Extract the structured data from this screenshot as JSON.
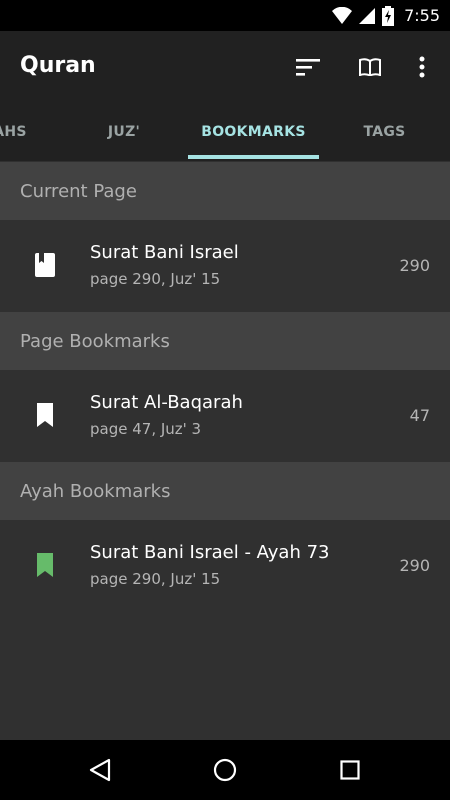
{
  "status_bar": {
    "time": "7:55",
    "icons": [
      "wifi-icon",
      "signal-icon",
      "battery-charging-icon"
    ]
  },
  "toolbar": {
    "title": "Quran",
    "actions": [
      "sort-icon",
      "open-book-icon",
      "more-vert-icon"
    ]
  },
  "tabs": [
    {
      "label": "AHS",
      "active": false
    },
    {
      "label": "JUZ'",
      "active": false
    },
    {
      "label": "BOOKMARKS",
      "active": true
    },
    {
      "label": "TAGS",
      "active": false
    }
  ],
  "sections": {
    "current_page": {
      "header": "Current Page",
      "items": [
        {
          "title": "Surat Bani Israel",
          "subtitle": "page 290, Juz' 15",
          "count": "290",
          "icon": "book-page-icon"
        }
      ]
    },
    "page_bookmarks": {
      "header": "Page Bookmarks",
      "items": [
        {
          "title": "Surat Al-Baqarah",
          "subtitle": "page 47, Juz' 3",
          "count": "47",
          "icon": "bookmark-icon"
        }
      ]
    },
    "ayah_bookmarks": {
      "header": "Ayah Bookmarks",
      "items": [
        {
          "title": "Surat Bani Israel - Ayah 73",
          "subtitle": "page 290, Juz' 15",
          "count": "290",
          "icon": "bookmark-green-icon"
        }
      ]
    }
  },
  "colors": {
    "toolbar_bg": "#212121",
    "content_bg": "#303030",
    "section_bg": "#424242",
    "tab_accent": "#a6e3e3",
    "ayah_bookmark": "#66bb6a"
  },
  "nav_bar": {
    "buttons": [
      "back-icon",
      "home-icon",
      "recents-icon"
    ]
  }
}
